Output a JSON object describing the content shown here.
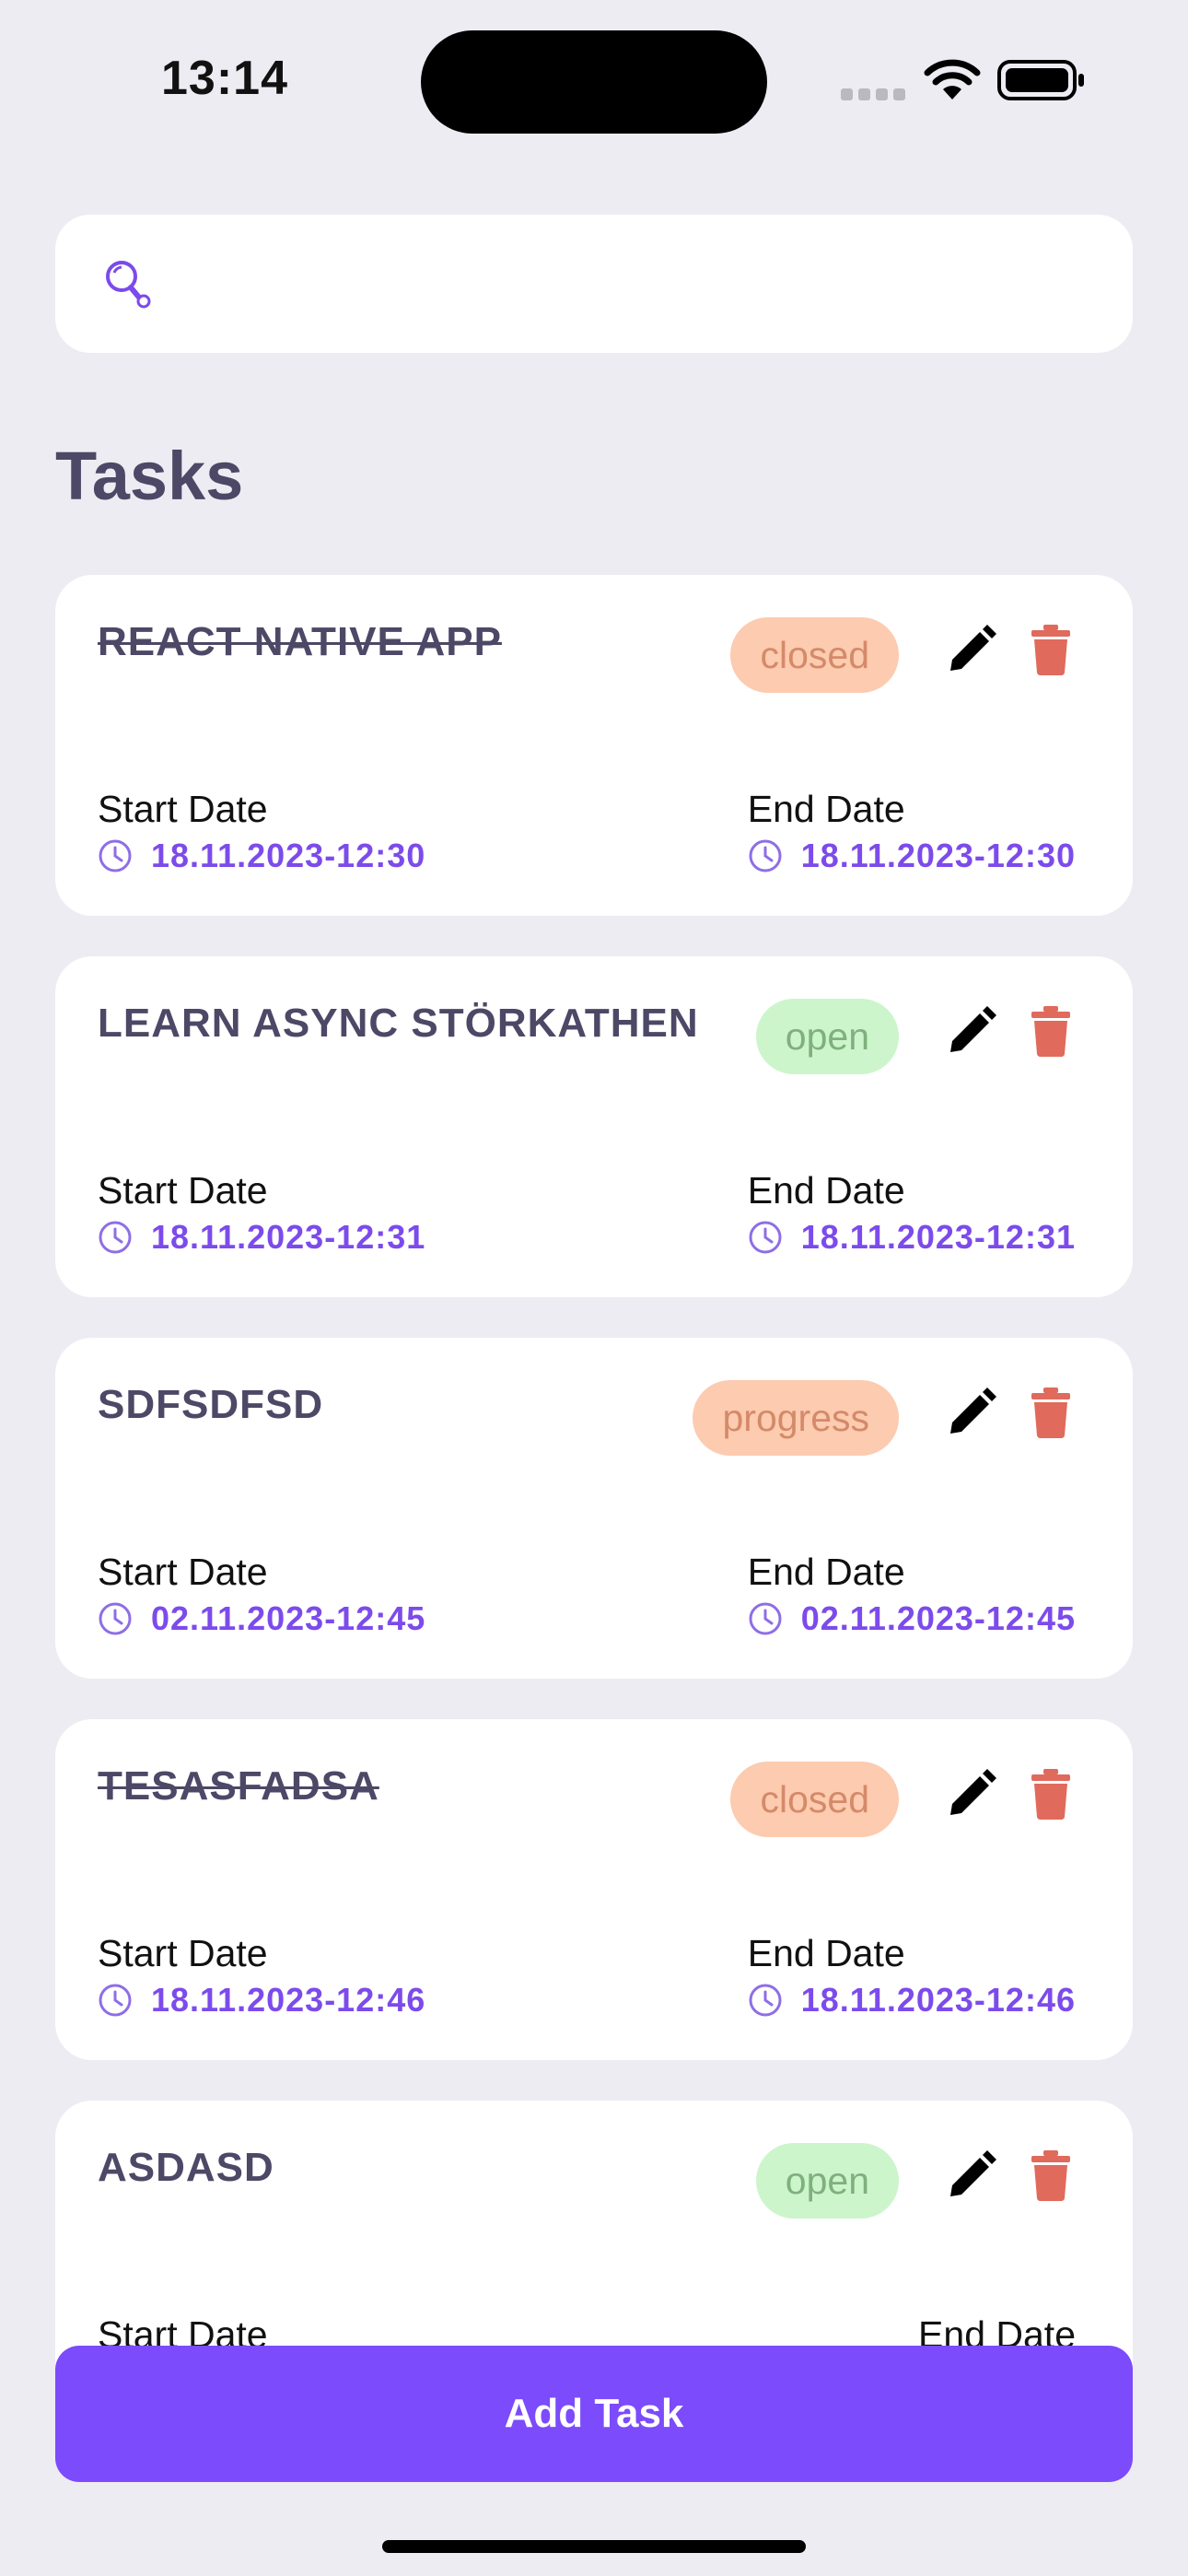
{
  "status_bar": {
    "time": "13:14"
  },
  "search": {
    "placeholder": ""
  },
  "section_title": "Tasks",
  "tasks": [
    {
      "title": "REACT NATIVE APP",
      "status": "closed",
      "done": true,
      "start_label": "Start Date",
      "start_value": "18.11.2023-12:30",
      "end_label": "End Date",
      "end_value": "18.11.2023-12:30"
    },
    {
      "title": "LEARN ASYNC STÖRKATHEN",
      "status": "open",
      "done": false,
      "start_label": "Start Date",
      "start_value": "18.11.2023-12:31",
      "end_label": "End Date",
      "end_value": "18.11.2023-12:31"
    },
    {
      "title": "SDFSDFSD",
      "status": "progress",
      "done": false,
      "start_label": "Start Date",
      "start_value": "02.11.2023-12:45",
      "end_label": "End Date",
      "end_value": "02.11.2023-12:45"
    },
    {
      "title": "TESASFADSA",
      "status": "closed",
      "done": true,
      "start_label": "Start Date",
      "start_value": "18.11.2023-12:46",
      "end_label": "End Date",
      "end_value": "18.11.2023-12:46"
    },
    {
      "title": "ASDASD",
      "status": "open",
      "done": false,
      "start_label": "Start Date",
      "start_value": "",
      "end_label": "End Date",
      "end_value": ""
    }
  ],
  "icons": {
    "search": "magnifier-icon",
    "edit": "pencil-icon",
    "delete": "trash-icon",
    "date": "clock-icon"
  },
  "colors": {
    "accent": "#7C4BFB",
    "delete": "#E06A5C",
    "closed_bg": "#FCCBB0",
    "open_bg": "#CDF5CC",
    "background": "#EEECF3"
  },
  "add_task_label": "Add Task"
}
